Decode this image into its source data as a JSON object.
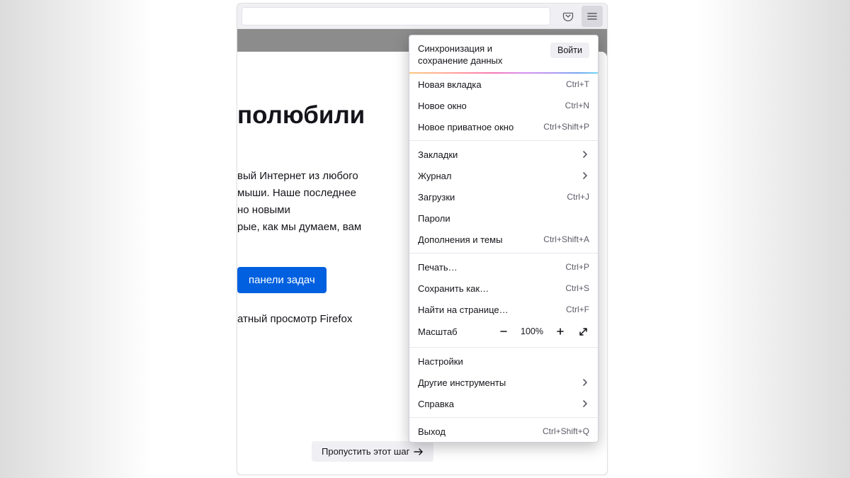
{
  "toolbar": {
    "pocket_icon": "pocket-icon",
    "menu_icon": "hamburger-icon"
  },
  "page": {
    "title_fragment": "полюбили",
    "body_lines": [
      "вый Интернет из любого",
      "мыши. Наше последнее",
      "но новыми",
      "рые, как мы думаем, вам"
    ],
    "cta_label": "панели задач",
    "sub_link": "атный просмотр Firefox",
    "skip_label": "Пропустить этот шаг"
  },
  "menu": {
    "sync_label": "Синхронизация и сохранение данных",
    "signin_label": "Войти",
    "group1": [
      {
        "label": "Новая вкладка",
        "shortcut": "Ctrl+T"
      },
      {
        "label": "Новое окно",
        "shortcut": "Ctrl+N"
      },
      {
        "label": "Новое приватное окно",
        "shortcut": "Ctrl+Shift+P"
      }
    ],
    "group2": [
      {
        "label": "Закладки",
        "chevron": true
      },
      {
        "label": "Журнал",
        "chevron": true
      },
      {
        "label": "Загрузки",
        "shortcut": "Ctrl+J"
      },
      {
        "label": "Пароли"
      },
      {
        "label": "Дополнения и темы",
        "shortcut": "Ctrl+Shift+A"
      }
    ],
    "group3": [
      {
        "label": "Печать…",
        "shortcut": "Ctrl+P"
      },
      {
        "label": "Сохранить как…",
        "shortcut": "Ctrl+S"
      },
      {
        "label": "Найти на странице…",
        "shortcut": "Ctrl+F"
      }
    ],
    "zoom": {
      "label": "Масштаб",
      "value": "100%"
    },
    "group4": [
      {
        "label": "Настройки"
      },
      {
        "label": "Другие инструменты",
        "chevron": true
      },
      {
        "label": "Справка",
        "chevron": true
      }
    ],
    "group5": [
      {
        "label": "Выход",
        "shortcut": "Ctrl+Shift+Q"
      }
    ]
  }
}
